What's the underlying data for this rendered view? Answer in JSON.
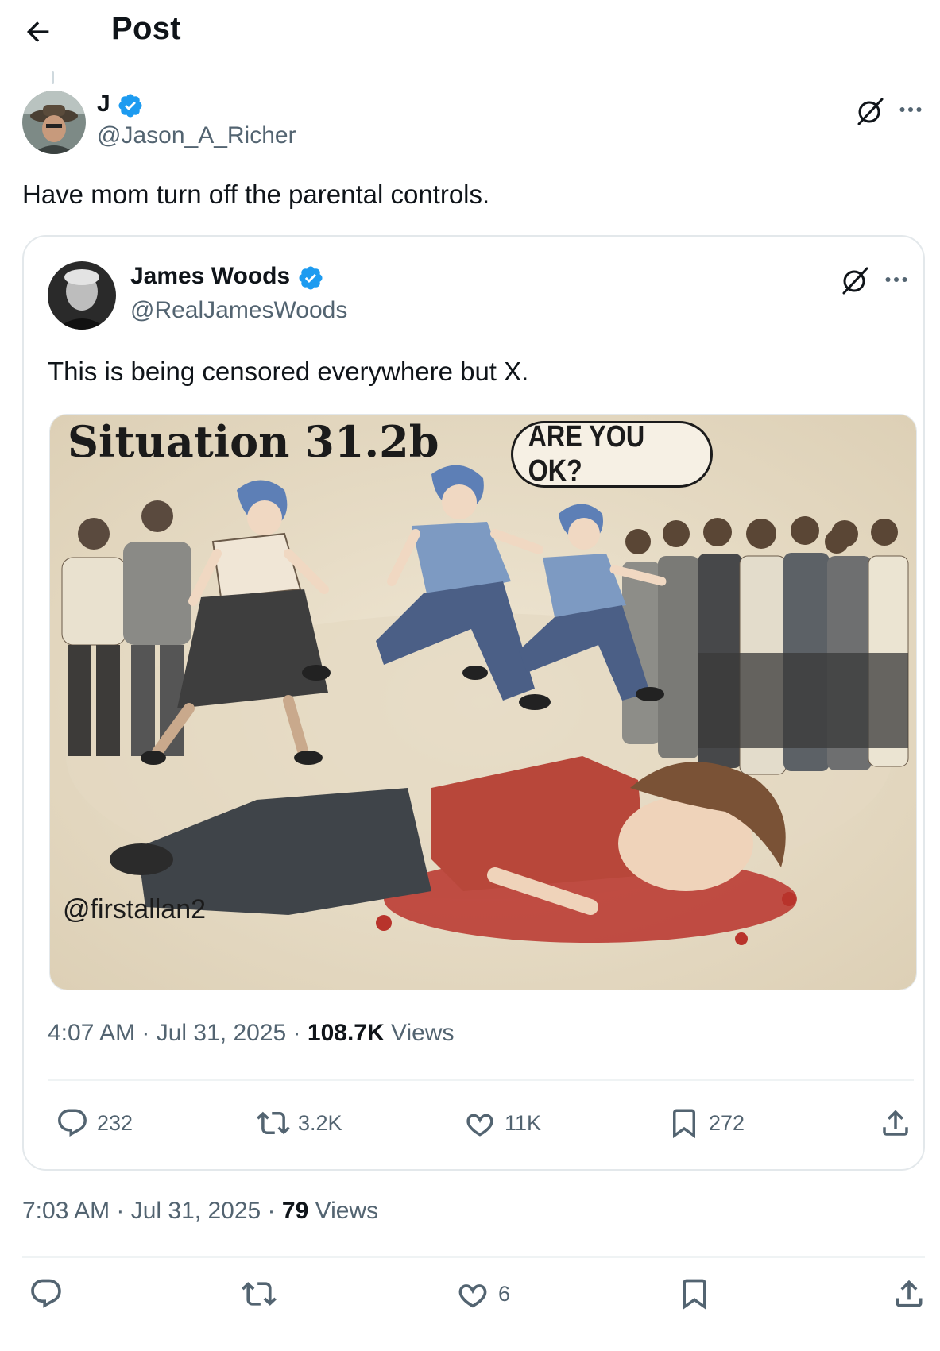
{
  "header": {
    "title": "Post"
  },
  "icons": {
    "back": "arrow-left-icon",
    "grok": "grok-icon",
    "more": "more-horizontal-icon",
    "reply": "reply-icon",
    "repost": "repost-icon",
    "like": "heart-icon",
    "bookmark": "bookmark-icon",
    "share": "share-icon",
    "verified": "verified-badge-icon"
  },
  "colors": {
    "verified": "#1d9bf0",
    "muted": "#536471",
    "text": "#0f1419",
    "border": "#e3e8eb"
  },
  "post": {
    "display_name": "J",
    "handle": "@Jason_A_Richer",
    "text": "Have mom turn off the parental controls.",
    "time": "7:03 AM",
    "date": "Jul 31, 2025",
    "views_count": "79",
    "views_label": "Views",
    "stats": {
      "replies": "",
      "reposts": "",
      "likes": "6",
      "bookmarks": ""
    }
  },
  "quoted": {
    "display_name": "James Woods",
    "handle": "@RealJamesWoods",
    "text": "This is being censored everywhere but X.",
    "time": "4:07 AM",
    "date": "Jul 31, 2025",
    "views_count": "108.7K",
    "views_label": "Views",
    "stats": {
      "replies": "232",
      "reposts": "3.2K",
      "likes": "11K",
      "bookmarks": "272"
    },
    "media": {
      "title": "Situation 31.2b",
      "speech": "ARE YOU OK?",
      "credit": "@firstallan2"
    }
  }
}
